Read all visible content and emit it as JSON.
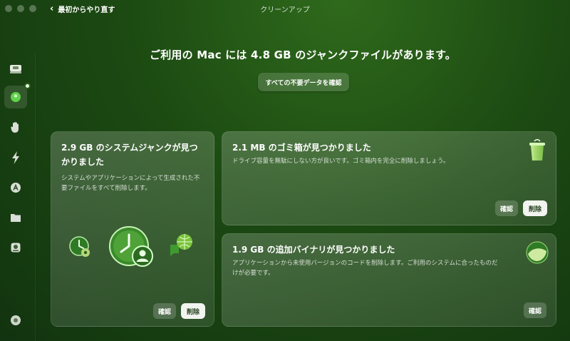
{
  "window": {
    "title": "クリーンアップ",
    "back_label": "最初からやり直す"
  },
  "header": {
    "headline": "ご利用の Mac には 4.8 GB のジャンクファイルがあります。",
    "review_all_label": "すべての不要データを確認"
  },
  "sidebar": {
    "items": [
      {
        "icon": "disk-icon"
      },
      {
        "icon": "cleanup-icon",
        "active": true
      },
      {
        "icon": "hand-icon"
      },
      {
        "icon": "bolt-icon"
      },
      {
        "icon": "app-store-icon"
      },
      {
        "icon": "folder-icon"
      },
      {
        "icon": "hdd-icon"
      },
      {
        "icon": "account-icon"
      }
    ]
  },
  "cards": {
    "system_junk": {
      "title": "2.9 GB のシステムジャンクが見つかりました",
      "description": "システムやアプリケーションによって生成された不要ファイルをすべて削除します。",
      "review_label": "確認",
      "delete_label": "削除"
    },
    "trash": {
      "title": "2.1 MB のゴミ箱が見つかりました",
      "description": "ドライブ容量を無駄にしない方が良いです。ゴミ箱内を完全に削除しましょう。",
      "review_label": "確認",
      "delete_label": "削除"
    },
    "binaries": {
      "title": "1.9 GB の追加バイナリが見つかりました",
      "description": "アプリケーションから未使用バージョンのコードを削除します。ご利用のシステムに合ったものだけが必要です。",
      "review_label": "確認"
    }
  },
  "colors": {
    "accent": "#4fcf3c",
    "background": "#1c4a12",
    "delete_button": "#f2f4f0"
  }
}
